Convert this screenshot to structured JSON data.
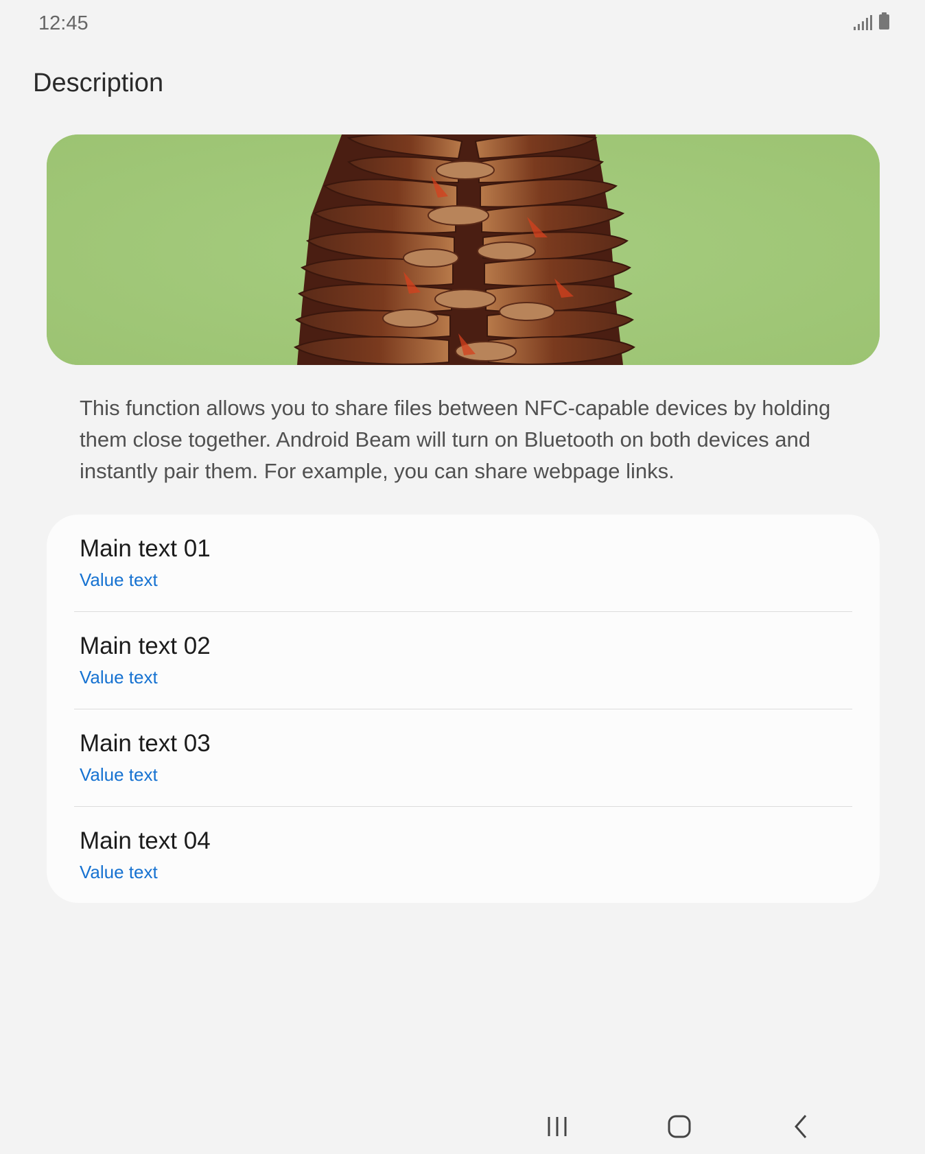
{
  "status_bar": {
    "time": "12:45",
    "icons": [
      "signal-icon",
      "battery-icon"
    ]
  },
  "page": {
    "title": "Description"
  },
  "hero_image": {
    "subject": "pine-cone",
    "background_color": "#a2c978"
  },
  "description": {
    "text": "This function allows you to share files between NFC-capable devices by holding them close together. Android Beam will  turn on Bluetooth on both devices and instantly pair them. For example, you can share webpage links."
  },
  "list": {
    "items": [
      {
        "main": "Main text 01",
        "value": "Value text"
      },
      {
        "main": "Main text 02",
        "value": "Value text"
      },
      {
        "main": "Main text 03",
        "value": "Value text"
      },
      {
        "main": "Main text 04",
        "value": "Value text"
      }
    ]
  },
  "colors": {
    "background": "#f3f3f3",
    "card": "#fcfcfc",
    "value_text": "#1672d1"
  },
  "nav_bar": {
    "buttons": [
      "recents-icon",
      "home-icon",
      "back-icon"
    ]
  }
}
